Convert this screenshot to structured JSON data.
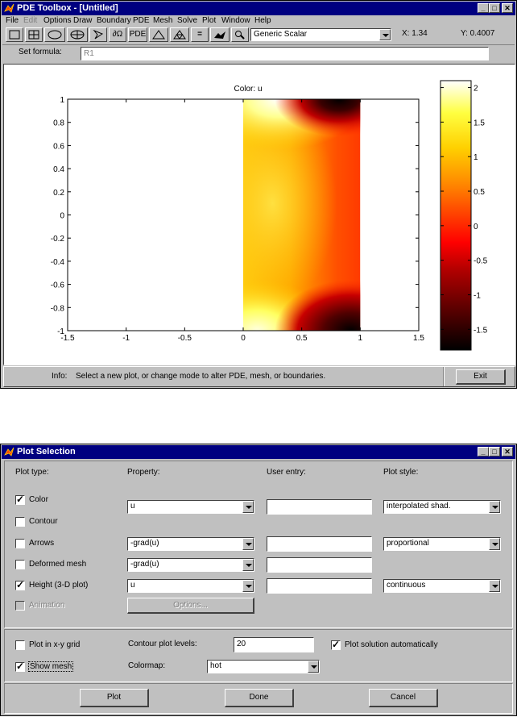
{
  "main_window": {
    "title": "PDE Toolbox - [Untitled]",
    "menu": [
      "File",
      "Edit",
      "Options",
      "Draw",
      "Boundary",
      "PDE",
      "Mesh",
      "Solve",
      "Plot",
      "Window",
      "Help"
    ],
    "toolbar": {
      "pde_label": "PDE",
      "domain_label": "∂Ω",
      "equals_label": "=",
      "select_value": "Generic Scalar",
      "x_coord": "X: 1.34",
      "y_coord": "Y: 0.4007"
    },
    "formula": {
      "label": "Set formula:",
      "value": "R1"
    },
    "status": {
      "info_label": "Info:",
      "info_text": "Select a new plot, or change mode to alter PDE, mesh, or boundaries.",
      "exit_label": "Exit"
    }
  },
  "chart_data": {
    "type": "heatmap",
    "title": "Color: u",
    "xlim": [
      -1.5,
      1.5
    ],
    "ylim": [
      -1,
      1
    ],
    "x_ticks": [
      "-1.5",
      "-1",
      "-0.5",
      "0",
      "0.5",
      "1",
      "1.5"
    ],
    "y_ticks": [
      "1",
      "0.8",
      "0.6",
      "0.4",
      "0.2",
      "0",
      "-0.2",
      "-0.4",
      "-0.6",
      "-0.8",
      "-1"
    ],
    "domain": {
      "x": [
        0,
        1
      ],
      "y": [
        -1,
        1
      ]
    },
    "colormap": "hot",
    "colorbar_range": [
      -1.8,
      2.1
    ],
    "colorbar_ticks": [
      "2",
      "1.5",
      "1",
      "0.5",
      "0",
      "-0.5",
      "-1",
      "-1.5"
    ]
  },
  "plot_dialog": {
    "title": "Plot Selection",
    "headers": {
      "plot_type": "Plot type:",
      "property": "Property:",
      "user_entry": "User entry:",
      "plot_style": "Plot style:"
    },
    "rows": [
      {
        "label": "Color",
        "checked": true,
        "property": "u",
        "style": "interpolated shad."
      },
      {
        "label": "Contour",
        "checked": false
      },
      {
        "label": "Arrows",
        "checked": false,
        "property": "-grad(u)",
        "style": "proportional"
      },
      {
        "label": "Deformed mesh",
        "checked": false,
        "property": "-grad(u)"
      },
      {
        "label": "Height (3-D plot)",
        "checked": true,
        "property": "u",
        "style": "continuous"
      },
      {
        "label": "Animation",
        "checked": false,
        "disabled": true,
        "options_label": "Options..."
      }
    ],
    "plot_in_grid": {
      "label": "Plot in x-y grid",
      "checked": false
    },
    "show_mesh": {
      "label": "Show mesh",
      "checked": true
    },
    "contour_levels": {
      "label": "Contour plot levels:",
      "value": "20"
    },
    "plot_auto": {
      "label": "Plot solution automatically",
      "checked": true
    },
    "colormap": {
      "label": "Colormap:",
      "value": "hot"
    },
    "buttons": {
      "plot": "Plot",
      "done": "Done",
      "cancel": "Cancel"
    }
  },
  "colors": {
    "titlebar": "#000080",
    "face": "#c0c0c0",
    "icon": "#ff4000"
  }
}
